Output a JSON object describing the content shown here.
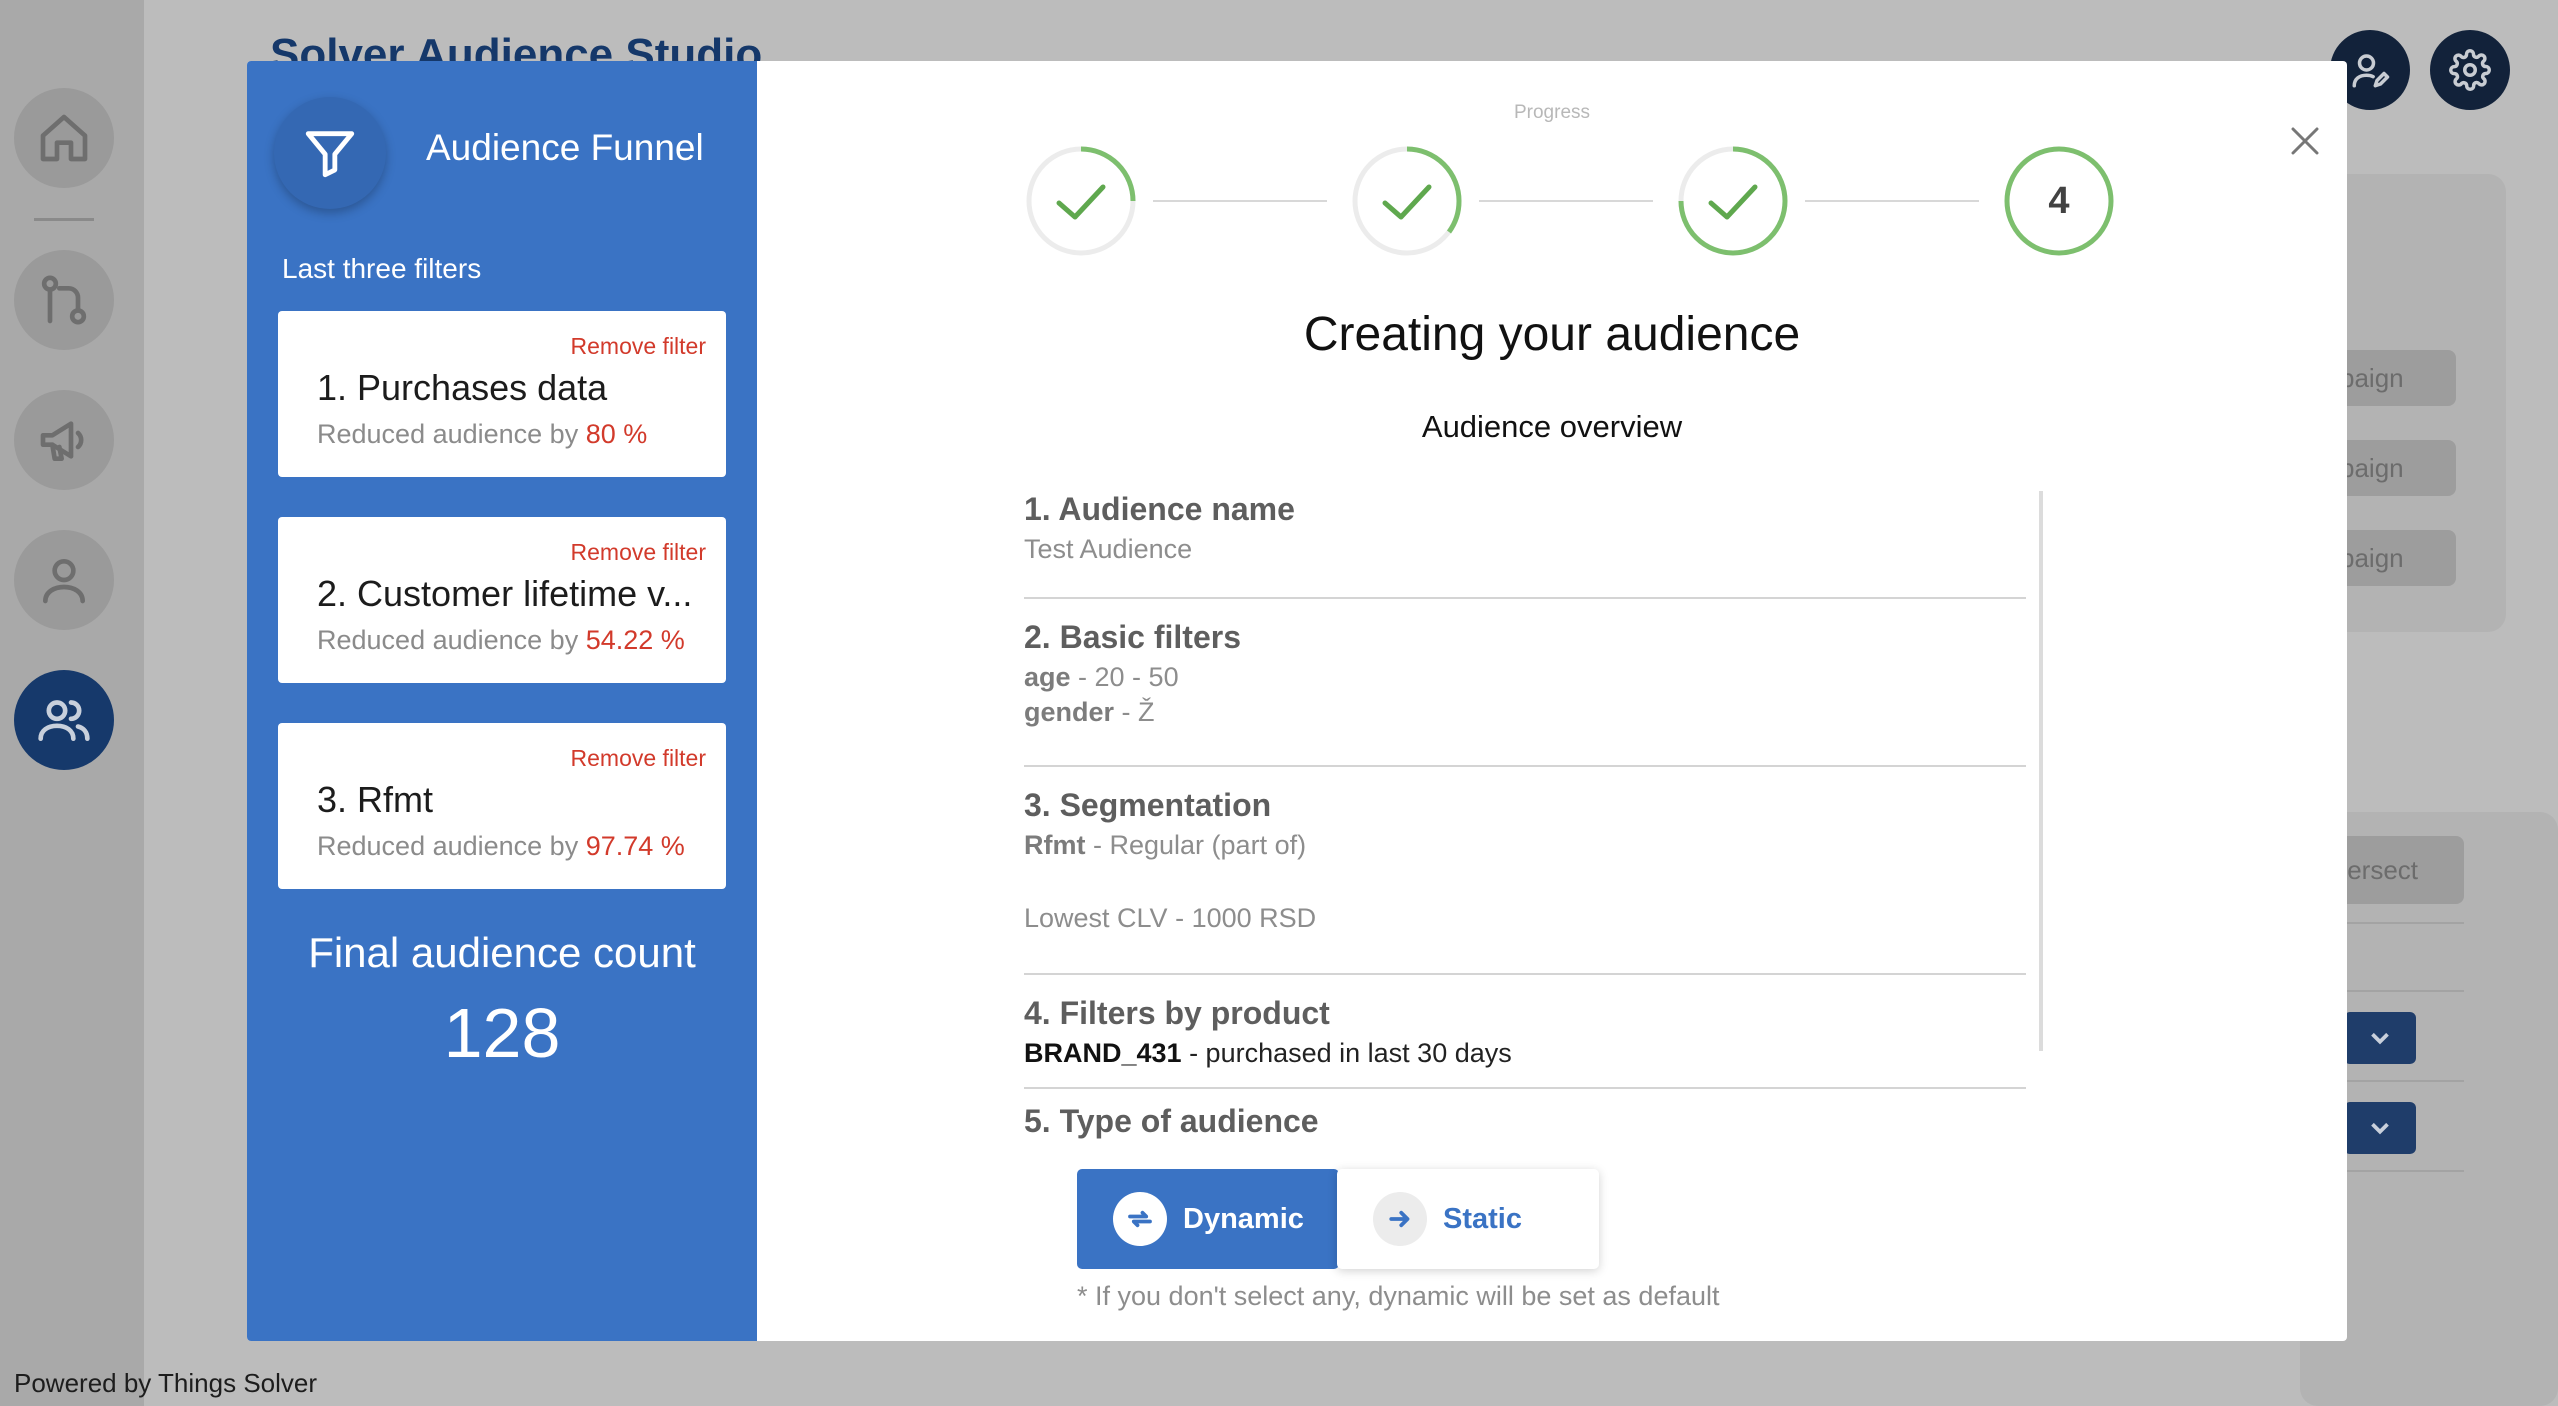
{
  "app": {
    "title": "Solver Audience Studio",
    "powered_by": "Powered by Things Solver"
  },
  "background": {
    "campaign_buttons": [
      "paign",
      "paign",
      "paign"
    ],
    "intersect_button": "tersect"
  },
  "sidebar": {
    "items": [
      {
        "icon": "home-icon"
      },
      {
        "icon": "flow-icon"
      },
      {
        "icon": "megaphone-icon"
      },
      {
        "icon": "user-icon"
      },
      {
        "icon": "users-icon",
        "active": true
      }
    ]
  },
  "funnel": {
    "title": "Audience Funnel",
    "subtitle": "Last three filters",
    "filters": [
      {
        "remove_label": "Remove filter",
        "name": "1. Purchases data",
        "reduced_label": "Reduced audience by",
        "percent": "80 %"
      },
      {
        "remove_label": "Remove filter",
        "name": "2. Customer lifetime v...",
        "reduced_label": "Reduced audience by",
        "percent": "54.22 %"
      },
      {
        "remove_label": "Remove filter",
        "name": "3. Rfmt",
        "reduced_label": "Reduced audience by",
        "percent": "97.74 %"
      }
    ],
    "final_label": "Final audience count",
    "final_count": "128"
  },
  "progress": {
    "label": "Progress",
    "steps": [
      {
        "state": "done"
      },
      {
        "state": "done"
      },
      {
        "state": "done"
      },
      {
        "state": "current",
        "number": "4"
      }
    ]
  },
  "main": {
    "heading": "Creating your audience",
    "overview_title": "Audience overview",
    "sections": {
      "name": {
        "title": "1. Audience name",
        "value": "Test Audience"
      },
      "basic": {
        "title": "2. Basic filters",
        "age_key": "age",
        "age_value": " - 20 - 50",
        "gender_key": "gender",
        "gender_value": " - Ž"
      },
      "segmentation": {
        "title": "3. Segmentation",
        "rfmt_key": "Rfmt",
        "rfmt_value": " - Regular (part of)",
        "clv": "Lowest CLV - 1000 RSD"
      },
      "product": {
        "title": "4. Filters by product",
        "brand_key": "BRAND_431",
        "brand_value": " - purchased in last 30 days"
      },
      "type": {
        "title": "5. Type of audience",
        "dynamic_label": "Dynamic",
        "static_label": "Static",
        "hint": "* If you don't select any, dynamic will be set as default"
      }
    }
  },
  "colors": {
    "primary": "#3a73c4",
    "danger": "#d23a2b",
    "success": "#7dbf6e",
    "navy": "#15386a"
  }
}
